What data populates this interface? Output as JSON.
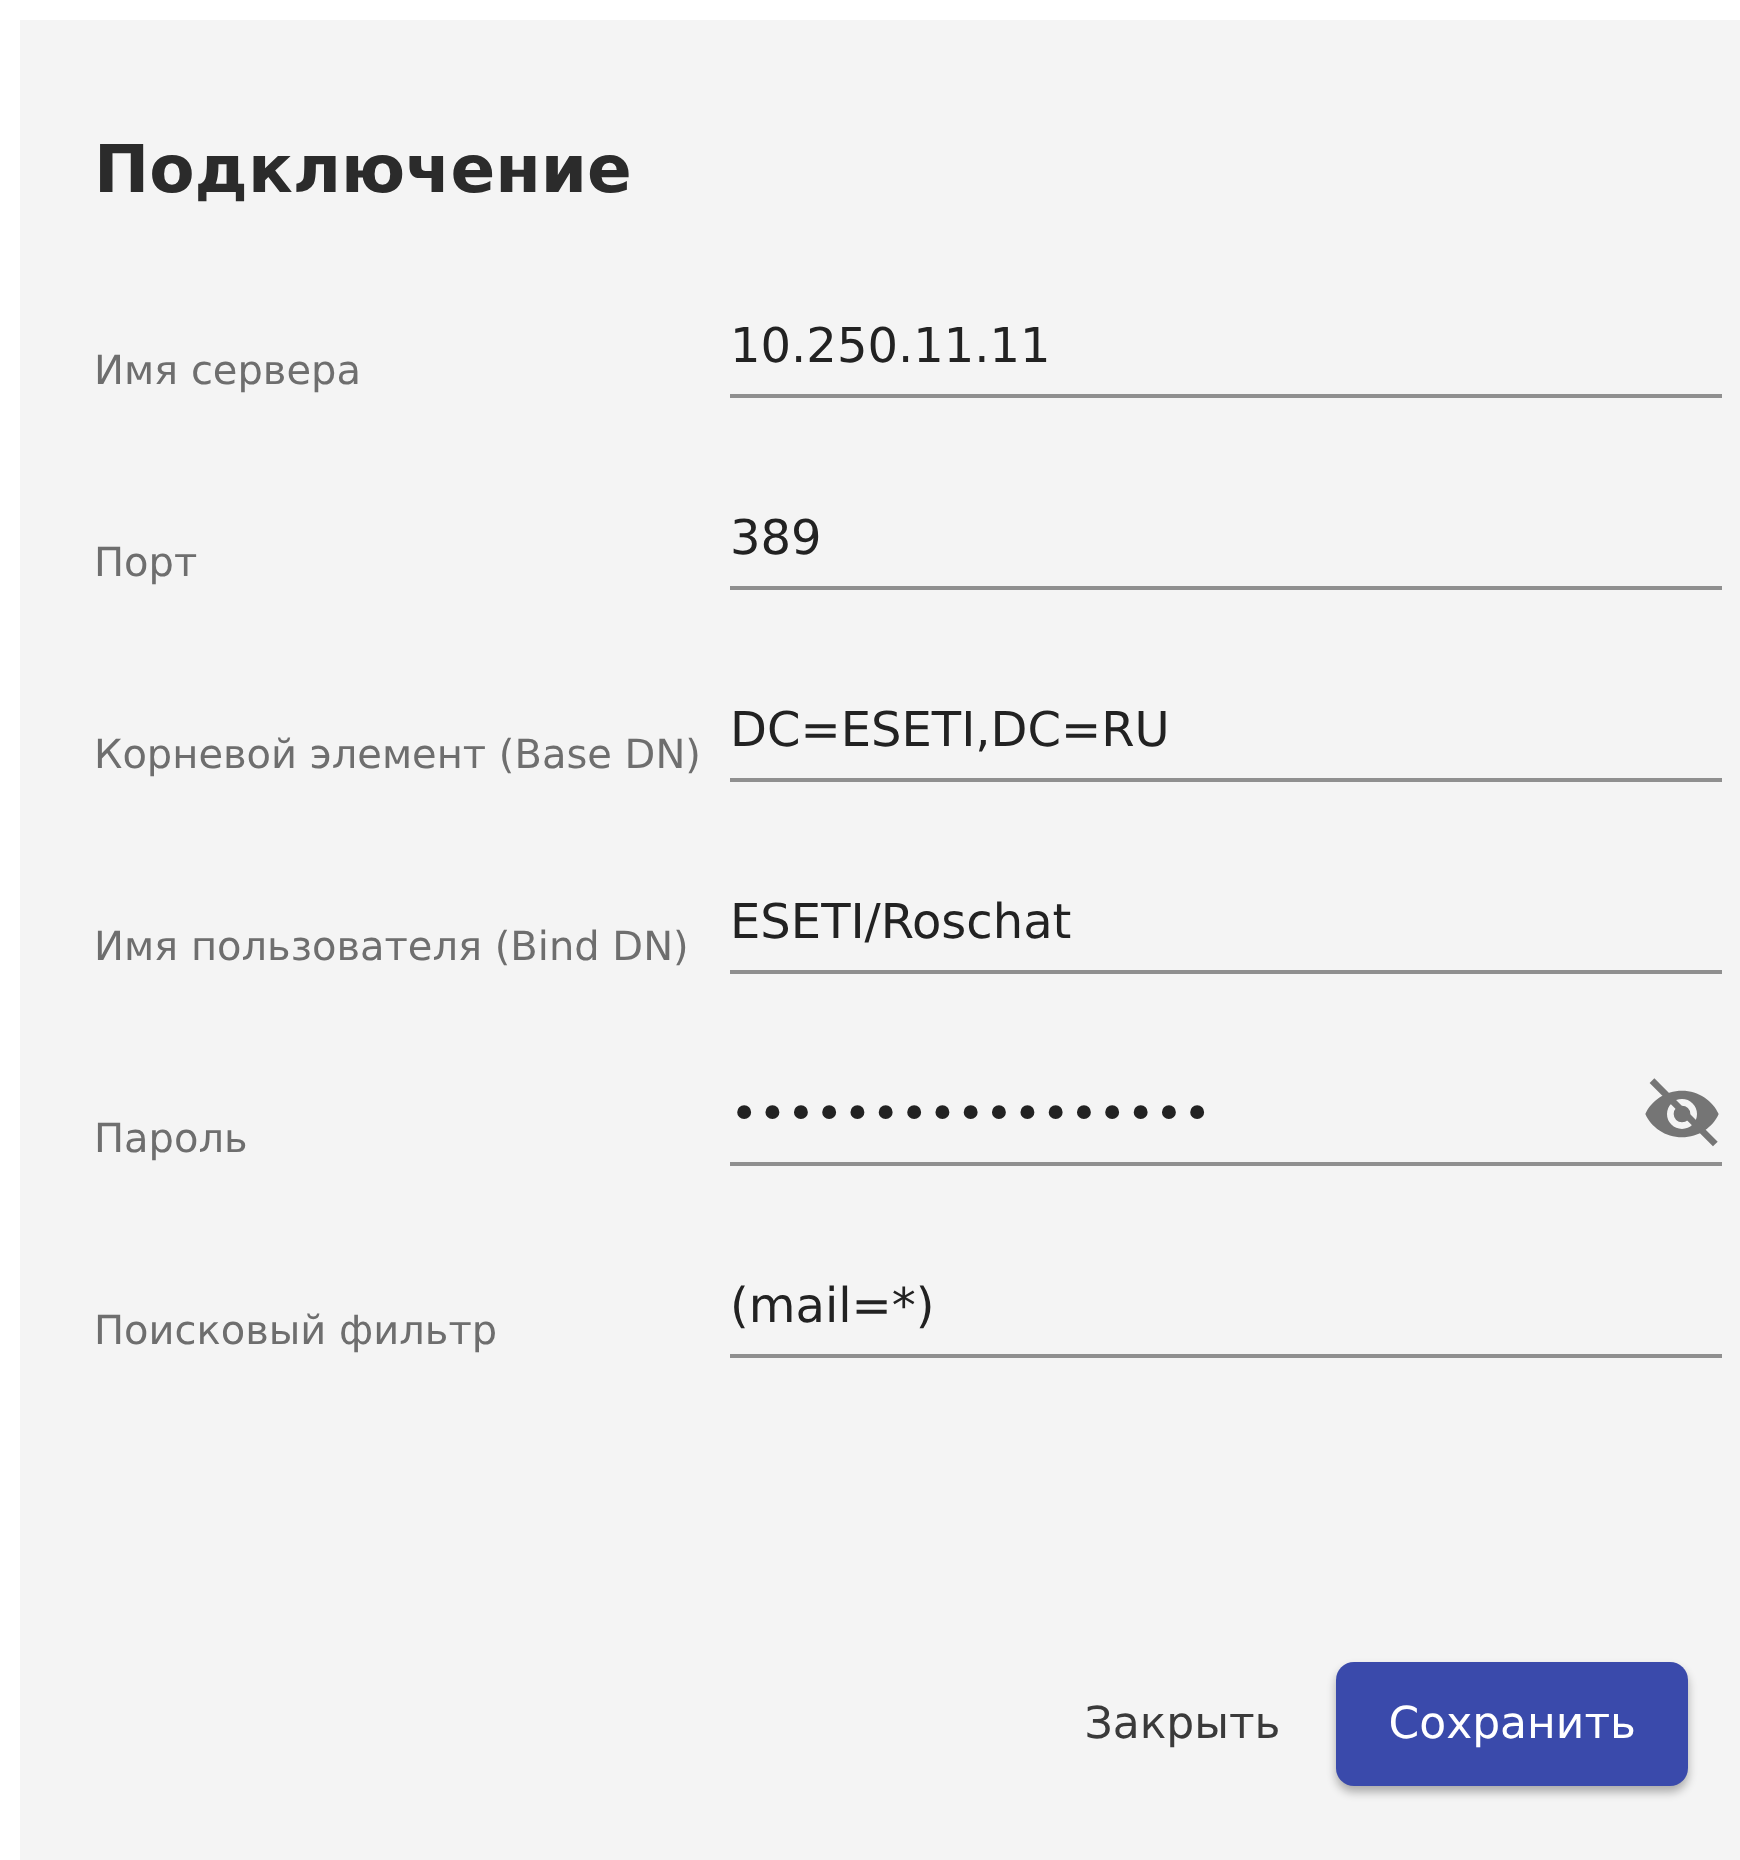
{
  "dialog": {
    "title": "Подключение",
    "fields": [
      {
        "kind": "text",
        "label": "Имя сервера",
        "value": "10.250.11.11"
      },
      {
        "kind": "text",
        "label": "Порт",
        "value": "389"
      },
      {
        "kind": "text",
        "label": "Корневой элемент (Base DN)",
        "value": "DC=ESETI,DC=RU"
      },
      {
        "kind": "text",
        "label": "Имя пользователя (Bind DN)",
        "value": "ESETI/Roschat"
      },
      {
        "kind": "password",
        "label": "Пароль",
        "value": "•••••••••••••••••",
        "revealed": false
      },
      {
        "kind": "text",
        "label": "Поисковый фильтр",
        "value": "(mail=*)"
      }
    ],
    "buttons": [
      {
        "kind": "text",
        "label": "Закрыть"
      },
      {
        "kind": "primary",
        "label": "Сохранить"
      }
    ]
  }
}
